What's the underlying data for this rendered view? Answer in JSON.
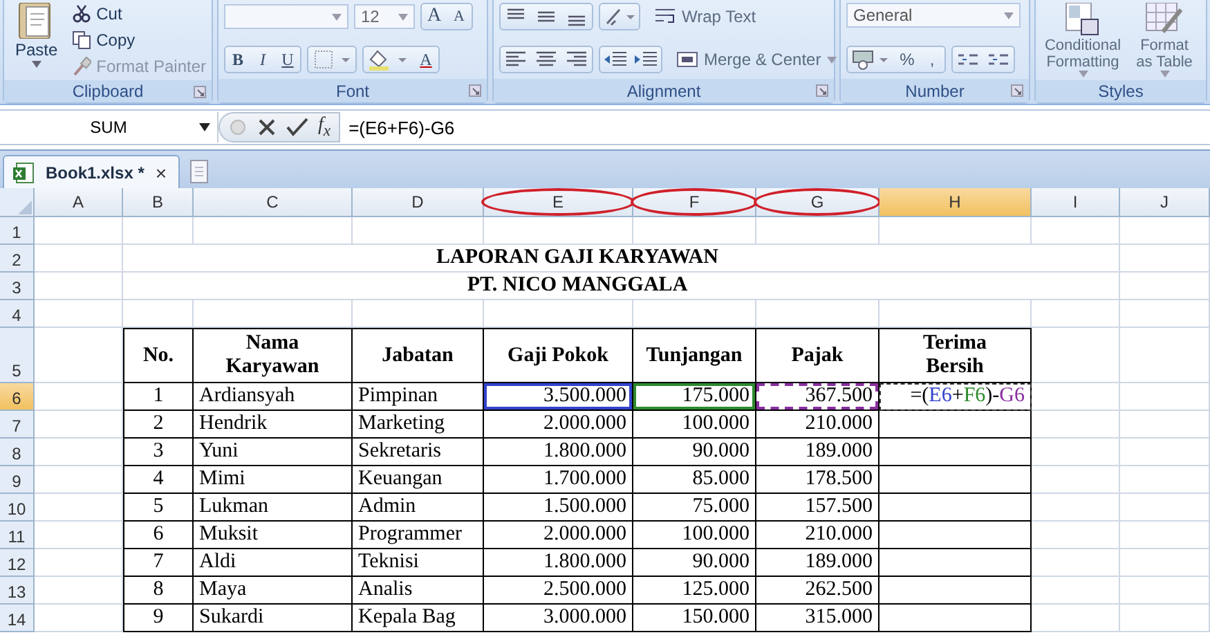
{
  "ribbon": {
    "groups": [
      {
        "kind": "clipboard",
        "label": "Clipboard",
        "paste": "Paste",
        "items": [
          "Cut",
          "Copy",
          "Format Painter"
        ]
      },
      {
        "kind": "font",
        "label": "Font",
        "font_size": "12",
        "grow": "A",
        "shrink": "A",
        "styles": [
          "B",
          "I",
          "U"
        ],
        "font_color": "A"
      },
      {
        "kind": "alignment",
        "label": "Alignment",
        "wrap": "Wrap Text",
        "merge": "Merge & Center"
      },
      {
        "kind": "number",
        "label": "Number",
        "format": "General",
        "percent": "%",
        "comma": ","
      },
      {
        "kind": "styles",
        "label": "Styles",
        "conditional": "Conditional Formatting",
        "table": "Format as Table"
      }
    ]
  },
  "formula_bar": {
    "name_box": "SUM",
    "function_label": "f$_{x}$",
    "formula": "=(E6+F6)-G6"
  },
  "tabs": [
    {
      "label": "Book1.xlsx *",
      "close": "×",
      "selected": true
    }
  ],
  "sheet": {
    "columns": [
      {
        "label": "A",
        "selected": false,
        "circled": false
      },
      {
        "label": "B",
        "selected": false,
        "circled": false
      },
      {
        "label": "C",
        "selected": false,
        "circled": false
      },
      {
        "label": "D",
        "selected": false,
        "circled": false
      },
      {
        "label": "E",
        "selected": false,
        "circled": true
      },
      {
        "label": "F",
        "selected": false,
        "circled": true
      },
      {
        "label": "G",
        "selected": false,
        "circled": true
      },
      {
        "label": "H",
        "selected": true,
        "circled": false
      },
      {
        "label": "I",
        "selected": false,
        "circled": false
      },
      {
        "label": "J",
        "selected": false,
        "circled": false
      }
    ],
    "rows": [
      {
        "label": "1",
        "selected": false
      },
      {
        "label": "2",
        "selected": false
      },
      {
        "label": "3",
        "selected": false
      },
      {
        "label": "4",
        "selected": false
      },
      {
        "label": "5",
        "selected": false
      },
      {
        "label": "6",
        "selected": true
      },
      {
        "label": "7",
        "selected": false
      },
      {
        "label": "8",
        "selected": false
      },
      {
        "label": "9",
        "selected": false
      },
      {
        "label": "10",
        "selected": false
      },
      {
        "label": "11",
        "selected": false
      },
      {
        "label": "12",
        "selected": false
      },
      {
        "label": "13",
        "selected": false
      },
      {
        "label": "14",
        "selected": false
      }
    ],
    "title_lines": [
      "LAPORAN GAJI KARYAWAN",
      "PT. NICO MANGGALA"
    ],
    "table": {
      "columns": [
        {
          "label": "No.",
          "kind": "index"
        },
        {
          "label": "Nama Karyawan",
          "kind": "text"
        },
        {
          "label": "Jabatan",
          "kind": "text"
        },
        {
          "label": "Gaji Pokok",
          "kind": "number"
        },
        {
          "label": "Tunjangan",
          "kind": "number"
        },
        {
          "label": "Pajak",
          "kind": "number"
        },
        {
          "label": "Terima Bersih",
          "kind": "number"
        }
      ],
      "rows": [
        {
          "cells": [
            {
              "text": "1"
            },
            {
              "text": "Ardiansyah"
            },
            {
              "text": "Pimpinan"
            },
            {
              "text": "3.500.000",
              "color": "#3344cc"
            },
            {
              "text": "175.000",
              "color": "#2e8b2e"
            },
            {
              "text": "367.500",
              "color": "#8a2fa0",
              "marquee": true
            },
            {
              "kind": "formula",
              "editing": true,
              "parts": [
                {
                  "text": "=(",
                  "color": "#000000"
                },
                {
                  "text": "E6",
                  "color": "#3344cc"
                },
                {
                  "text": "+",
                  "color": "#000000"
                },
                {
                  "text": "F6",
                  "color": "#2e8b2e"
                },
                {
                  "text": ")-",
                  "color": "#000000"
                },
                {
                  "text": "G6",
                  "color": "#8a2fa0"
                }
              ]
            }
          ]
        },
        {
          "cells": [
            {
              "text": "2"
            },
            {
              "text": "Hendrik"
            },
            {
              "text": "Marketing"
            },
            {
              "text": "2.000.000"
            },
            {
              "text": "100.000"
            },
            {
              "text": "210.000"
            }
          ]
        },
        {
          "cells": [
            {
              "text": "3"
            },
            {
              "text": "Yuni"
            },
            {
              "text": "Sekretaris"
            },
            {
              "text": "1.800.000"
            },
            {
              "text": "90.000"
            },
            {
              "text": "189.000"
            }
          ]
        },
        {
          "cells": [
            {
              "text": "4"
            },
            {
              "text": "Mimi"
            },
            {
              "text": "Keuangan"
            },
            {
              "text": "1.700.000"
            },
            {
              "text": "85.000"
            },
            {
              "text": "178.500"
            }
          ]
        },
        {
          "cells": [
            {
              "text": "5"
            },
            {
              "text": "Lukman"
            },
            {
              "text": "Admin"
            },
            {
              "text": "1.500.000"
            },
            {
              "text": "75.000"
            },
            {
              "text": "157.500"
            }
          ]
        },
        {
          "cells": [
            {
              "text": "6"
            },
            {
              "text": "Muksit"
            },
            {
              "text": "Programmer"
            },
            {
              "text": "2.000.000"
            },
            {
              "text": "100.000"
            },
            {
              "text": "210.000"
            }
          ]
        },
        {
          "cells": [
            {
              "text": "7"
            },
            {
              "text": "Aldi"
            },
            {
              "text": "Teknisi"
            },
            {
              "text": "1.800.000"
            },
            {
              "text": "90.000"
            },
            {
              "text": "189.000"
            }
          ]
        },
        {
          "cells": [
            {
              "text": "8"
            },
            {
              "text": "Maya"
            },
            {
              "text": "Analis"
            },
            {
              "text": "2.500.000"
            },
            {
              "text": "125.000"
            },
            {
              "text": "262.500"
            }
          ]
        },
        {
          "cells": [
            {
              "text": "9"
            },
            {
              "text": "Sukardi"
            },
            {
              "text": "Kepala Bag"
            },
            {
              "text": "3.000.000"
            },
            {
              "text": "150.000"
            },
            {
              "text": "315.000"
            }
          ]
        }
      ]
    }
  }
}
